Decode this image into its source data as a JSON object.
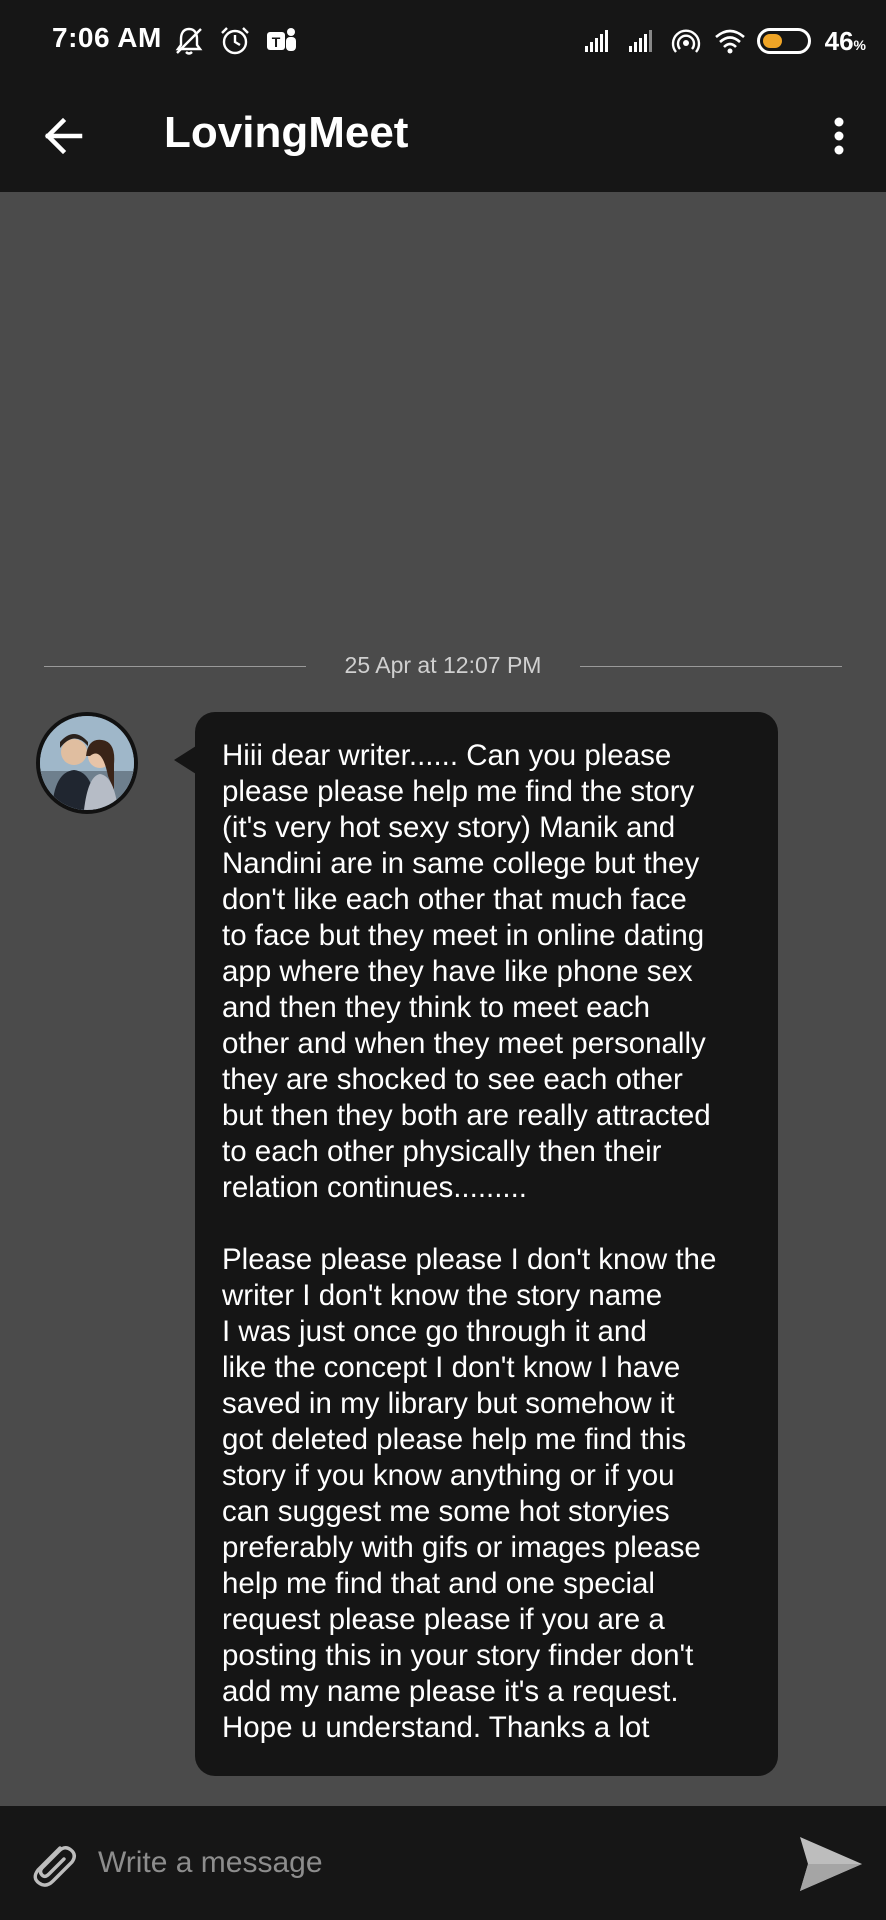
{
  "status_bar": {
    "time": "7:06 AM",
    "battery_percent": "46",
    "battery_unit": "%",
    "battery_level": 0.46,
    "icons_left": [
      "bell-muted-icon",
      "alarm-icon",
      "teams-icon"
    ],
    "icons_right": [
      "signal-icon",
      "signal-icon",
      "hotspot-icon",
      "wifi-icon",
      "battery-icon"
    ]
  },
  "app_bar": {
    "title": "LovingMeet",
    "back_icon": "arrow-left-icon",
    "menu_icon": "more-vertical-icon"
  },
  "chat": {
    "date_separator": "25 Apr at 12:07 PM",
    "message": {
      "paragraph_1": "Hiii dear writer...... Can you please\nplease please help me find the story\n(it's very hot sexy story) Manik and\nNandini are in same college but they\ndon't like each other that much face\nto face but they meet in online dating\napp where they have like phone sex\nand then they think to meet each\nother and when they meet personally\nthey are shocked to see each other\nbut then they both are really attracted\nto each other physically then their\nrelation continues.........",
      "paragraph_2": "Please please please I don't know the\nwriter I don't know the story name\nI was just once go through it and\nlike the concept I don't know I have\nsaved in my library but somehow it\ngot deleted please help me find this\nstory if you know anything or if you\ncan suggest me some hot storyies\npreferably with gifs or images please\nhelp me find that and one special\nrequest please please if you are a\nposting this in your story finder don't\nadd my name please it's a request.\nHope u understand. Thanks a lot"
    }
  },
  "composer": {
    "placeholder": "Write a message",
    "attach_icon": "paperclip-icon",
    "send_icon": "send-icon"
  },
  "colors": {
    "bar_background": "#161616",
    "chat_background": "#4b4b4b",
    "bubble_background": "#151515",
    "battery_accent": "#f0a526"
  }
}
